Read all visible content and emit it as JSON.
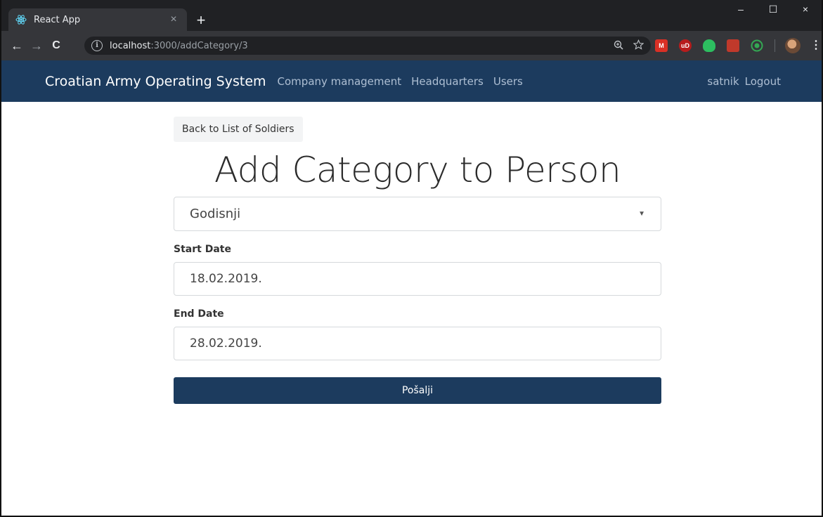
{
  "browser": {
    "tab_title": "React App",
    "tab_close": "×",
    "new_tab": "+",
    "url_host": "localhost",
    "url_path": ":3000/addCategory/3",
    "info_glyph": "i",
    "window": {
      "minimize": "–",
      "maximize": "☐",
      "close": "×"
    },
    "nav": {
      "back": "←",
      "forward": "→",
      "reload": "C"
    },
    "icons": {
      "favicon": "react-icon",
      "zoom": "zoom-icon",
      "bookmark": "star-icon",
      "menu": "kebab-menu-icon"
    },
    "extensions": [
      {
        "name": "gmail-icon",
        "label": "M",
        "color": "#d93025"
      },
      {
        "name": "ublock-icon",
        "label": "uD",
        "color": "#b71c1c"
      },
      {
        "name": "evernote-icon",
        "label": "",
        "color": "#2dbe60"
      },
      {
        "name": "extension-icon",
        "label": "",
        "color": "#c0392b"
      },
      {
        "name": "circle-extension-icon",
        "label": "",
        "color": "#34a853"
      }
    ]
  },
  "navbar": {
    "brand": "Croatian Army Operating System",
    "links": [
      "Company management",
      "Headquarters",
      "Users"
    ],
    "user": "satnik",
    "logout": "Logout",
    "bg_color": "#1c3b5e"
  },
  "form": {
    "back_label": "Back to List of Soldiers",
    "title": "Add Category to Person",
    "category_selected": "Godisnji",
    "start_label": "Start Date",
    "start_value": "18.02.2019.",
    "end_label": "End Date",
    "end_value": "28.02.2019.",
    "submit_label": "Pošalji"
  }
}
